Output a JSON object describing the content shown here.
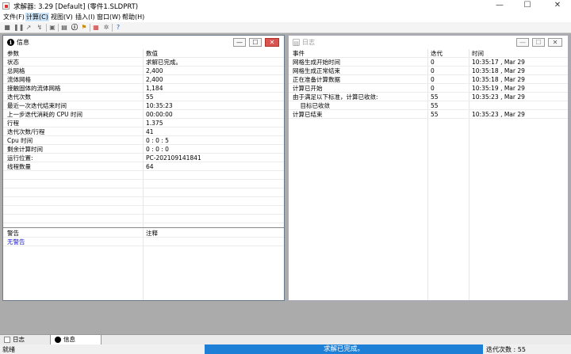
{
  "window": {
    "title": "求解器: 3.29 [Default] (零件1.SLDPRT)",
    "min": "—",
    "max": "☐",
    "close": "✕"
  },
  "menu": [
    {
      "label": "文件(F)",
      "active": false
    },
    {
      "label": "计算(C)",
      "active": true
    },
    {
      "label": "视图(V)",
      "active": false
    },
    {
      "label": "插入(I)",
      "active": false
    },
    {
      "label": "窗口(W)",
      "active": false
    },
    {
      "label": "帮助(H)",
      "active": false
    }
  ],
  "info_panel": {
    "title": "信息",
    "headers": [
      "参数",
      "数值"
    ],
    "rows": [
      [
        "状态",
        "求解已完成。"
      ],
      [
        "总网格",
        "2,400"
      ],
      [
        "流体网格",
        "2,400"
      ],
      [
        "接触固体的流体网格",
        "1,184"
      ],
      [
        "迭代次数",
        "55"
      ],
      [
        "最近一次迭代结束时间",
        "10:35:23"
      ],
      [
        "上一步迭代消耗的 CPU 时间",
        "00:00:00"
      ],
      [
        "行程",
        "1.375"
      ],
      [
        "迭代次数/行程",
        "41"
      ],
      [
        "Cpu 时间",
        "0 : 0 : 5"
      ],
      [
        "剩余计算时间",
        "0 : 0 : 0"
      ],
      [
        "运行位置:",
        "PC-202109141841"
      ],
      [
        "线程数量",
        "64"
      ]
    ],
    "warn_headers": [
      "警告",
      "注释"
    ],
    "warn_rows": [
      [
        "无警告",
        ""
      ]
    ]
  },
  "log_panel": {
    "title": "日志",
    "headers": [
      "事件",
      "迭代",
      "时间"
    ],
    "rows": [
      [
        "网格生成开始时间",
        "0",
        "10:35:17 , Mar 29"
      ],
      [
        "网格生成正常结束",
        "0",
        "10:35:18 , Mar 29"
      ],
      [
        "正在准备计算数据",
        "0",
        "10:35:18 , Mar 29"
      ],
      [
        "计算已开始",
        "0",
        "10:35:19 , Mar 29"
      ],
      [
        "由于满足以下标准，计算已收敛:",
        "55",
        "10:35:23 , Mar 29"
      ],
      [
        "    目标已收敛",
        "55",
        ""
      ],
      [
        "计算已结束",
        "55",
        "10:35:23 , Mar 29"
      ]
    ]
  },
  "tabs": [
    {
      "label": "日志"
    },
    {
      "label": "信息"
    }
  ],
  "status": {
    "left": "就绪",
    "progress_text": "求解已完成。",
    "progress_fraction": 1.0,
    "right": "迭代次数 : 55"
  },
  "colors": {
    "accent": "#1e7fd6",
    "close_active": "#d9534f",
    "warning_link": "#1a1acc"
  }
}
